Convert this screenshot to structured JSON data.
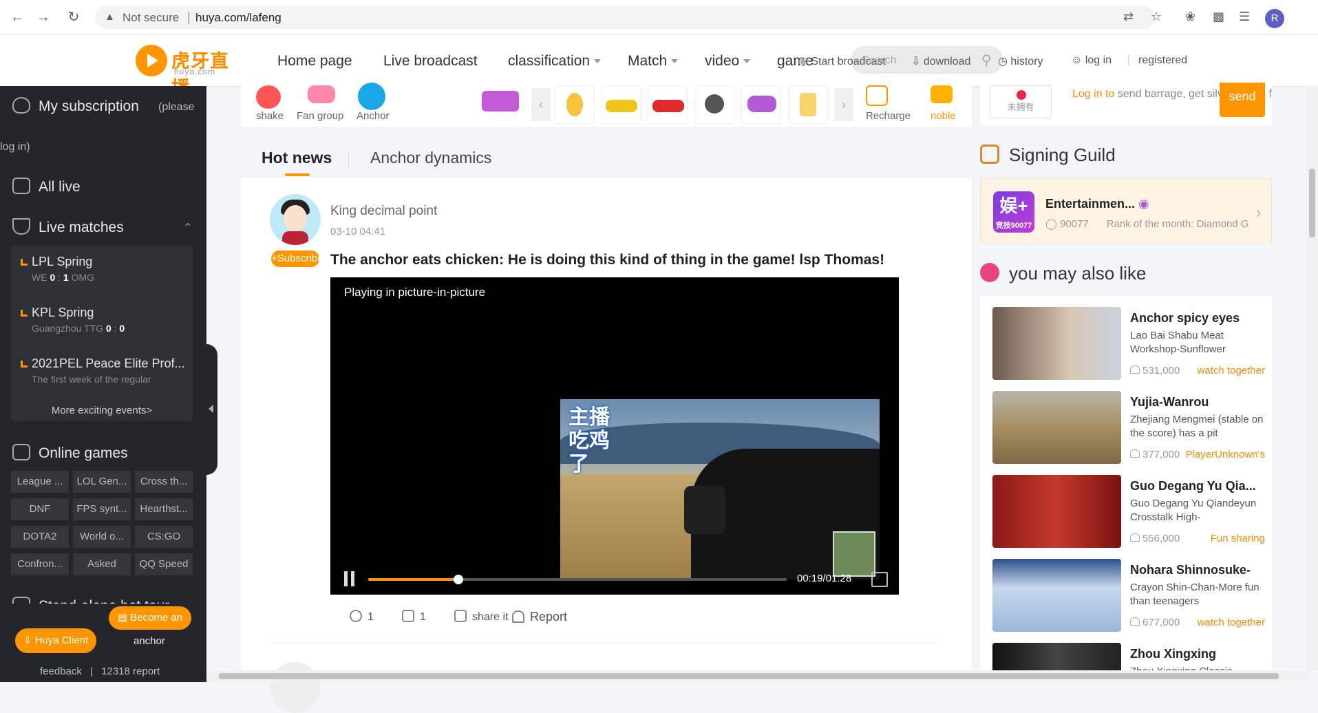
{
  "browser": {
    "security_label": "Not secure",
    "url": "huya.com/lafeng",
    "profile_initial": "R"
  },
  "header": {
    "logo_text": "虎牙直播",
    "logo_sub": "huya.com",
    "nav": [
      {
        "label": "Home page"
      },
      {
        "label": "Live broadcast"
      },
      {
        "label": "classification"
      },
      {
        "label": "Match"
      },
      {
        "label": "video"
      },
      {
        "label": "game"
      }
    ],
    "start_broadcast": "Start broadcast",
    "search_placeholder": "Search",
    "download": "download",
    "history": "history",
    "login": "log in",
    "register": "registered"
  },
  "sidebar": {
    "subscription": "My subscription",
    "subscription_note": "(please log in)",
    "all_live": "All live",
    "live_matches": "Live matches",
    "matches": [
      {
        "name": "LPL Spring",
        "team_a": "WE",
        "score_a": "0",
        "score_b": "1",
        "team_b": "OMG"
      },
      {
        "name": "KPL Spring",
        "team_a": "Guangzhou TTG",
        "score_a": "0",
        "score_b": "0",
        "team_b": ""
      },
      {
        "name": "2021PEL Peace Elite Prof...",
        "detail": "The first week of the regular"
      }
    ],
    "more_events": "More exciting events>",
    "online_games": "Online games",
    "games": [
      "League ...",
      "LOL Gen...",
      "Cross th...",
      "DNF",
      "FPS synt...",
      "Hearthst...",
      "DOTA2",
      "World o...",
      "CS:GO",
      "Confron...",
      "Asked",
      "QQ Speed"
    ],
    "standalone": "Stand-alone hot tour",
    "become_anchor_1": "Become an",
    "become_anchor_2": "anchor",
    "huya_client": "Huya Client",
    "feedback": "feedback",
    "report": "12318 report"
  },
  "gifts": {
    "shake": "shake",
    "fan_group": "Fan group",
    "anchor": "Anchor",
    "recharge": "Recharge",
    "noble": "noble"
  },
  "tabs": {
    "hot_news": "Hot news",
    "anchor_dynamics": "Anchor dynamics"
  },
  "post": {
    "author": "King decimal point",
    "time": "03-10 04:41",
    "subscribe": "+Subscribe",
    "title": "The anchor eats chicken: He is doing this kind of thing in the game! lsp Thomas!",
    "pip_text": "Playing in picture-in-picture",
    "overlay_text": "主播吃鸡了",
    "video_time": "00:19/01:28",
    "progress_fraction": 0.216,
    "comments": "1",
    "likes": "1",
    "share": "share it",
    "report": "Report"
  },
  "right": {
    "not_owned": "未拥有",
    "barrage_link": "Log in to",
    "barrage_text": "send barrage, get silver beans for free",
    "send": "send",
    "signing_guild": "Signing Guild",
    "guild": {
      "logo_text": "娱+",
      "logo_sub": "竞技90077",
      "name": "Entertainmen...",
      "id": "90077",
      "rank": "Rank of the month: Diamond G"
    },
    "you_may_like": "you may also like",
    "recommendations": [
      {
        "title": "Anchor spicy eyes",
        "desc": "Lao Bai Shabu Meat Workshop-Sunflower",
        "viewers": "531,000",
        "tag": "watch together"
      },
      {
        "title": "Yujia-Wanrou",
        "desc": "Zhejiang Mengmei (stable on the score) has a pit",
        "viewers": "377,000",
        "tag": "PlayerUnknown's"
      },
      {
        "title": "Guo Degang Yu Qia...",
        "desc": "Guo Degang Yu Qiandeyun Crosstalk High-",
        "viewers": "556,000",
        "tag": "Fun sharing"
      },
      {
        "title": "Nohara Shinnosuke-",
        "desc": "Crayon Shin-Chan-More fun than teenagers",
        "viewers": "677,000",
        "tag": "watch together"
      },
      {
        "title": "Zhou Xingxing",
        "desc": "Zhou Xingxing Classic",
        "viewers": "",
        "tag": ""
      }
    ]
  },
  "colors": {
    "accent": "#ff9600",
    "sidebar_bg": "#25262b"
  }
}
